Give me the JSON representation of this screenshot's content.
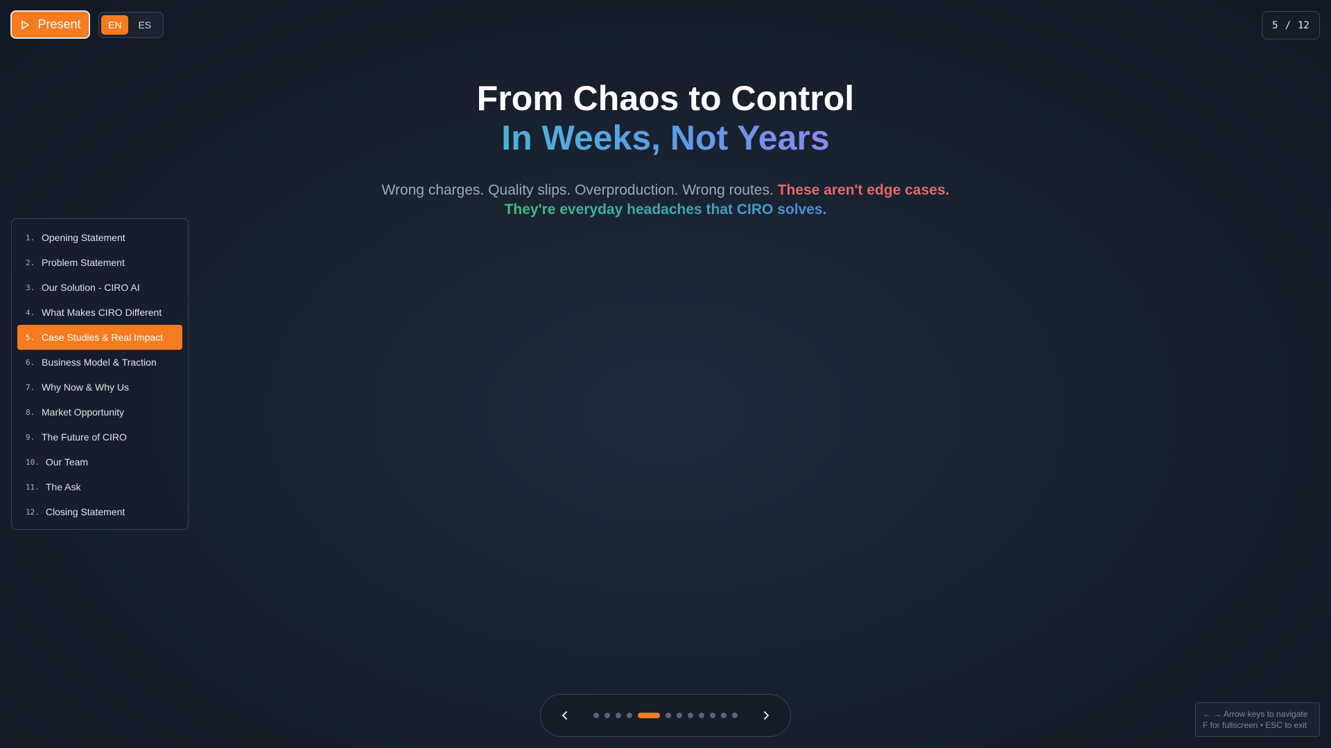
{
  "toolbar": {
    "present_label": "Present",
    "languages": [
      "EN",
      "ES"
    ],
    "active_language": "EN"
  },
  "counter": {
    "current": "5",
    "separator": "/",
    "total": "12"
  },
  "slide": {
    "title": "From Chaos to Control",
    "subtitle": "In Weeks, Not Years",
    "desc_plain": "Wrong charges. Quality slips. Overproduction. Wrong routes.",
    "desc_warning": "These aren't edge cases.",
    "desc_highlight": "They're everyday headaches that CIRO solves."
  },
  "slides": [
    {
      "num": "1.",
      "label": "Opening Statement"
    },
    {
      "num": "2.",
      "label": "Problem Statement"
    },
    {
      "num": "3.",
      "label": "Our Solution - CIRO AI"
    },
    {
      "num": "4.",
      "label": "What Makes CIRO Different"
    },
    {
      "num": "5.",
      "label": "Case Studies & Real Impact"
    },
    {
      "num": "6.",
      "label": "Business Model & Traction"
    },
    {
      "num": "7.",
      "label": "Why Now & Why Us"
    },
    {
      "num": "8.",
      "label": "Market Opportunity"
    },
    {
      "num": "9.",
      "label": "The Future of CIRO"
    },
    {
      "num": "10.",
      "label": "Our Team"
    },
    {
      "num": "11.",
      "label": "The Ask"
    },
    {
      "num": "12.",
      "label": "Closing Statement"
    }
  ],
  "active_slide_index": 4,
  "hint": {
    "line1": "← → Arrow keys to navigate",
    "line2": "F for fullscreen • ESC to exit"
  },
  "colors": {
    "accent": "#f47b20",
    "warning": "#e06b6b",
    "background": "#19222f"
  },
  "icons": {
    "present": "play-icon",
    "prev": "chevron-left-icon",
    "next": "chevron-right-icon"
  }
}
